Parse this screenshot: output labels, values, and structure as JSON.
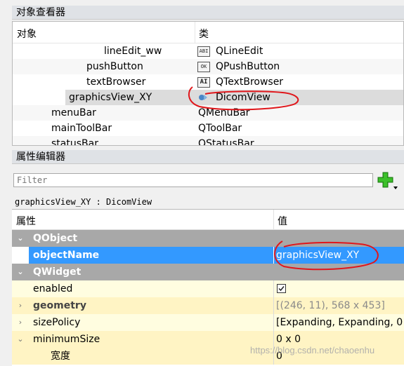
{
  "object_inspector": {
    "title": "对象查看器",
    "col_object": "对象",
    "col_class": "类",
    "rows": [
      {
        "name": "lineEdit_ww",
        "class": "QLineEdit",
        "icon": "lineedit-icon",
        "icon_text": "ABI"
      },
      {
        "name": "pushButton",
        "class": "QPushButton",
        "icon": "pushbutton-icon",
        "icon_text": "OK"
      },
      {
        "name": "textBrowser",
        "class": "QTextBrowser",
        "icon": "textbrowser-icon",
        "icon_text": "AI"
      },
      {
        "name": "graphicsView_XY",
        "class": "DicomView",
        "icon": "graphicsview-icon",
        "icon_text": ""
      },
      {
        "name": "menuBar",
        "class": "QMenuBar"
      },
      {
        "name": "mainToolBar",
        "class": "QToolBar"
      },
      {
        "name": "statusBar",
        "class": "QStatusBar"
      }
    ]
  },
  "property_editor": {
    "title": "属性编辑器",
    "filter_placeholder": "Filter",
    "object_label": "graphicsView_XY : DicomView",
    "col_property": "属性",
    "col_value": "值",
    "rows": [
      {
        "name": "QObject",
        "type": "group"
      },
      {
        "name": "objectName",
        "value": "graphicsView_XY"
      },
      {
        "name": "QWidget",
        "type": "group"
      },
      {
        "name": "enabled",
        "value_checked": true
      },
      {
        "name": "geometry",
        "value": "[(246, 11), 568 x 453]"
      },
      {
        "name": "sizePolicy",
        "value": "[Expanding, Expanding, 0"
      },
      {
        "name": "minimumSize",
        "value": "0 x 0"
      },
      {
        "name": "宽度",
        "value": "0"
      }
    ]
  },
  "watermark": "https://blog.csdn.net/chaoenhu",
  "colors": {
    "selection": "#3399ff",
    "group_header": "#a8a8a8",
    "annotation": "#e0161b",
    "add_icon": "#2fa820"
  }
}
